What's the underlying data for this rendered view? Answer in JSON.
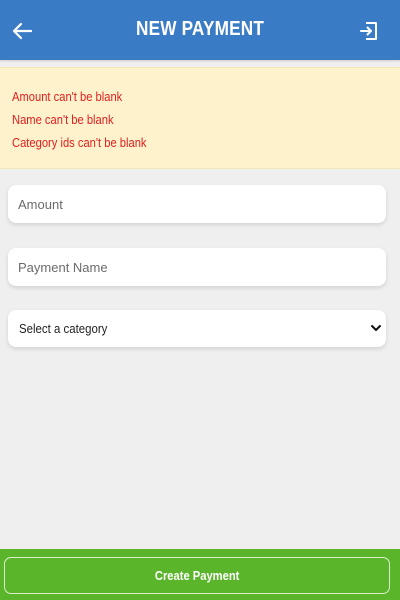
{
  "header": {
    "title": "NEW PAYMENT",
    "back_icon": "arrow-left-icon",
    "logout_icon": "sign-out-icon"
  },
  "errors": [
    "Amount can't be blank",
    "Name can't be blank",
    "Category ids can't be blank"
  ],
  "form": {
    "amount": {
      "value": "",
      "placeholder": "Amount"
    },
    "payment_name": {
      "value": "",
      "placeholder": "Payment Name"
    },
    "category": {
      "selected": "Select a category"
    }
  },
  "footer": {
    "submit_label": "Create Payment"
  },
  "colors": {
    "header": "#3a7bc6",
    "error_bg": "#fdf2cc",
    "error_text": "#e02020",
    "footer": "#5bb52a",
    "background": "#efefef"
  }
}
